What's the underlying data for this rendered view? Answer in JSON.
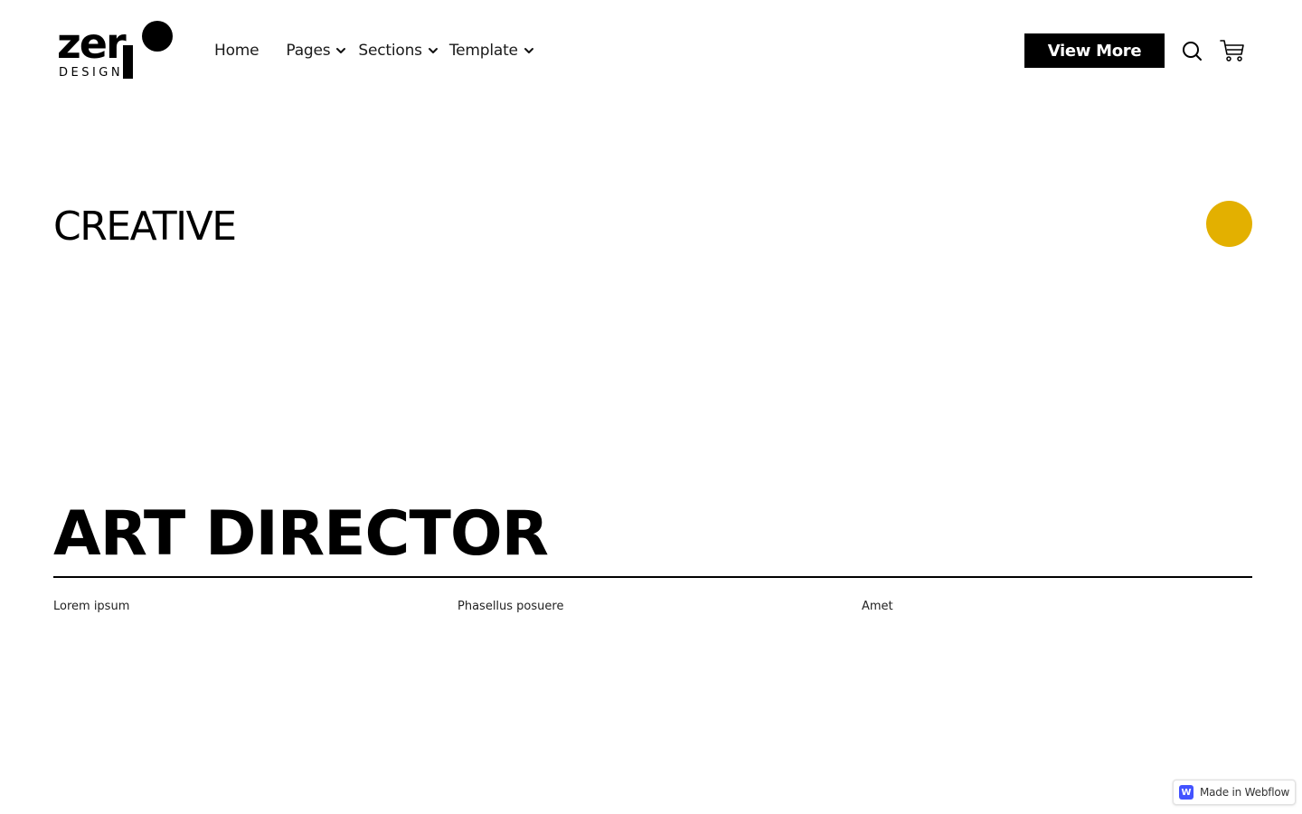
{
  "brand": {
    "logo_word": "zer",
    "logo_sub": "DESIGN"
  },
  "nav": {
    "items": [
      {
        "label": "Home"
      },
      {
        "label": "Pages"
      },
      {
        "label": "Sections"
      },
      {
        "label": "Template"
      }
    ]
  },
  "header": {
    "cta_label": "View More",
    "icons": [
      "search-icon",
      "cart-icon"
    ]
  },
  "hero": {
    "eyebrow": "CREATIVE",
    "title": "ART DIRECTOR",
    "accent_color": "#e3b000",
    "taglines": [
      "Lorem ipsum",
      "Phasellus posuere",
      "Amet"
    ]
  },
  "badge": {
    "mark": "W",
    "label": "Made in Webflow",
    "color": "#4353ff"
  }
}
